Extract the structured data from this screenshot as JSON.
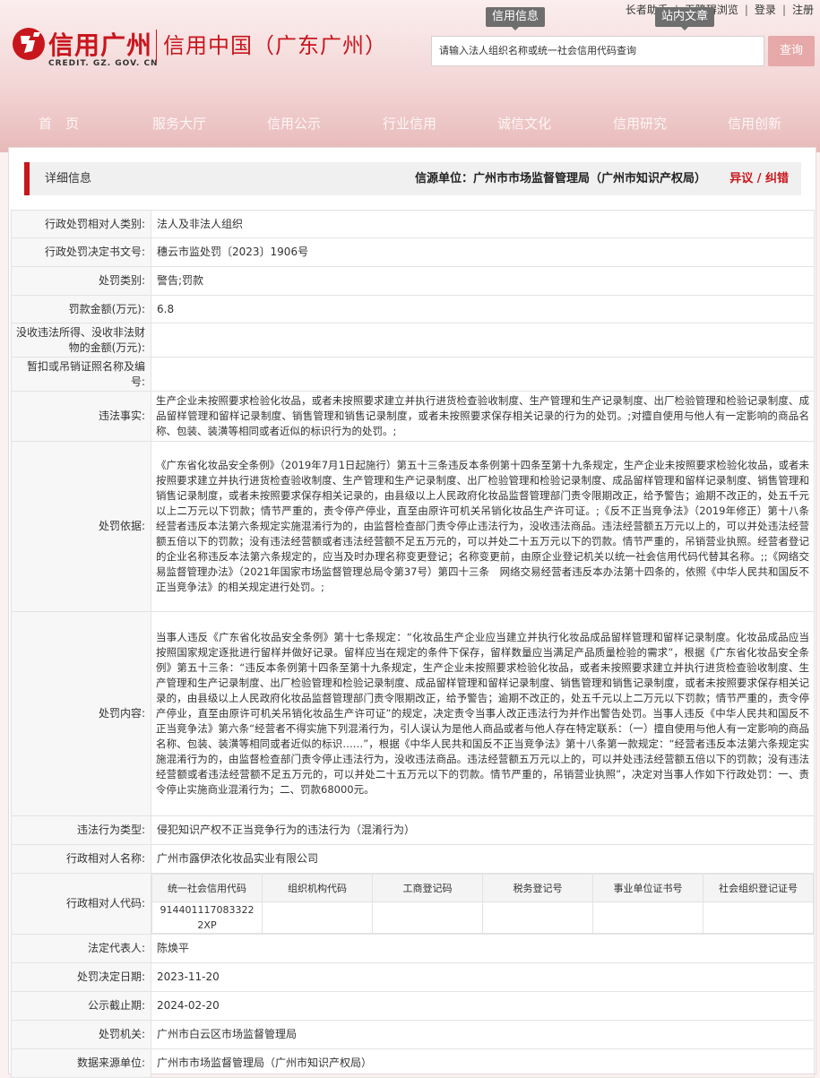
{
  "header": {
    "links": [
      "长者助手",
      "无障碍浏览",
      "登录",
      "注册"
    ],
    "logo_text": "信用广州",
    "logo_sub": "CREDIT. GZ. GOV. CN",
    "logo_right": "信用中国（广东广州）",
    "search_tabs": [
      "信用信息",
      "站内文章"
    ],
    "search_placeholder": "请输入法人组织名称或统一社会信用代码查询",
    "search_button": "查询",
    "nav": [
      "首　页",
      "服务大厅",
      "信用公示",
      "行业信用",
      "诚信文化",
      "信用研究",
      "信用创新"
    ]
  },
  "info_bar": {
    "title": "详细信息",
    "source": "信源单位：广州市市场监督管理局（广州市知识产权局）",
    "objection": "异议 / 纠错"
  },
  "rows": [
    {
      "label": "行政处罚相对人类别:",
      "value": "法人及非法人组织"
    },
    {
      "label": "行政处罚决定书文号:",
      "value": "穗云市监处罚〔2023〕1906号"
    },
    {
      "label": "处罚类别:",
      "value": "警告;罚款"
    },
    {
      "label": "罚款金额(万元):",
      "value": "6.8"
    },
    {
      "label": "没收违法所得、没收非法财物的金额(万元):",
      "value": ""
    },
    {
      "label": "暂扣或吊销证照名称及编号:",
      "value": ""
    },
    {
      "label": "违法事实:",
      "value": "生产企业未按照要求检验化妆品，或者未按照要求建立并执行进货检查验收制度、生产管理和生产记录制度、出厂检验管理和检验记录制度、成品留样管理和留样记录制度、销售管理和销售记录制度，或者未按照要求保存相关记录的行为的处罚。;对擅自使用与他人有一定影响的商品名称、包装、装潢等相同或者近似的标识行为的处罚。;"
    },
    {
      "label": "处罚依据:",
      "value": "《广东省化妆品安全条例》（2019年7月1日起施行）第五十三条违反本条例第十四条至第十九条规定，生产企业未按照要求检验化妆品，或者未按照要求建立并执行进货检查验收制度、生产管理和生产记录制度、出厂检验管理和检验记录制度、成品留样管理和留样记录制度、销售管理和销售记录制度，或者未按照要求保存相关记录的，由县级以上人民政府化妆品监督管理部门责令限期改正，给予警告；逾期不改正的，处五千元以上二万元以下罚款；情节严重的，责令停产停业，直至由原许可机关吊销化妆品生产许可证。;《反不正当竞争法》（2019年修正）第十八条　经营者违反本法第六条规定实施混淆行为的，由监督检查部门责令停止违法行为，没收违法商品。违法经营额五万元以上的，可以并处违法经营额五倍以下的罚款；没有违法经营额或者违法经营额不足五万元的，可以并处二十五万元以下的罚款。情节严重的，吊销营业执照。经营者登记的企业名称违反本法第六条规定的，应当及时办理名称变更登记；名称变更前，由原企业登记机关以统一社会信用代码代替其名称。;;《网络交易监督管理办法》（2021年国家市场监督管理总局令第37号）第四十三条　网络交易经营者违反本办法第十四条的，依照《中华人民共和国反不正当竞争法》的相关规定进行处罚。;"
    },
    {
      "label": "处罚内容:",
      "value": "当事人违反《广东省化妆品安全条例》第十七条规定：“化妆品生产企业应当建立并执行化妆品成品留样管理和留样记录制度。化妆品成品应当按照国家规定逐批进行留样并做好记录。留样应当在规定的条件下保存，留样数量应当满足产品质量检验的需求”，根据《广东省化妆品安全条例》第五十三条：“违反本条例第十四条至第十九条规定，生产企业未按照要求检验化妆品，或者未按照要求建立并执行进货检查验收制度、生产管理和生产记录制度、出厂检验管理和检验记录制度、成品留样管理和留样记录制度、销售管理和销售记录制度，或者未按照要求保存相关记录的，由县级以上人民政府化妆品监督管理部门责令限期改正，给予警告；逾期不改正的，处五千元以上二万元以下罚款；情节严重的，责令停产停业，直至由原许可机关吊销化妆品生产许可证”的规定，决定责令当事人改正违法行为并作出警告处罚。当事人违反《中华人民共和国反不正当竞争法》第六条“经营者不得实施下列混淆行为，引人误认为是他人商品或者与他人存在特定联系：（一）擅自使用与他人有一定影响的商品名称、包装、装潢等相同或者近似的标识……”，根据《中华人民共和国反不正当竞争法》第十八条第一款规定：“经营者违反本法第六条规定实施混淆行为的，由监督检查部门责令停止违法行为，没收违法商品。违法经营额五万元以上的，可以并处违法经营额五倍以下的罚款；没有违法经营额或者违法经营额不足五万元的，可以并处二十五万元以下的罚款。情节严重的，吊销营业执照”，决定对当事人作如下行政处罚：一、责令停止实施商业混淆行为；二、罚款68000元。"
    },
    {
      "label": "违法行为类型:",
      "value": "侵犯知识产权不正当竞争行为的违法行为（混淆行为）"
    },
    {
      "label": "行政相对人名称:",
      "value": "广州市露伊浓化妆品实业有限公司"
    }
  ],
  "codes": {
    "label": "行政相对人代码:",
    "headers": [
      "统一社会信用代码",
      "组织机构代码",
      "工商登记码",
      "税务登记号",
      "事业单位证书号",
      "社会组织登记证号"
    ],
    "values": [
      "914401117083322 2XP",
      "",
      "",
      "",
      "",
      ""
    ]
  },
  "rows_after": [
    {
      "label": "法定代表人:",
      "value": "陈焕平"
    },
    {
      "label": "处罚决定日期:",
      "value": "2023-11-20"
    },
    {
      "label": "公示截止期:",
      "value": "2024-02-20"
    },
    {
      "label": "处罚机关:",
      "value": "广州市白云区市场监督管理局"
    },
    {
      "label": "数据来源单位:",
      "value": "广州市市场监督管理局（广州市知识产权局）"
    }
  ],
  "colors": {
    "brand_red": "#c8161d",
    "header_gradient_end": "#e8b9b9"
  }
}
